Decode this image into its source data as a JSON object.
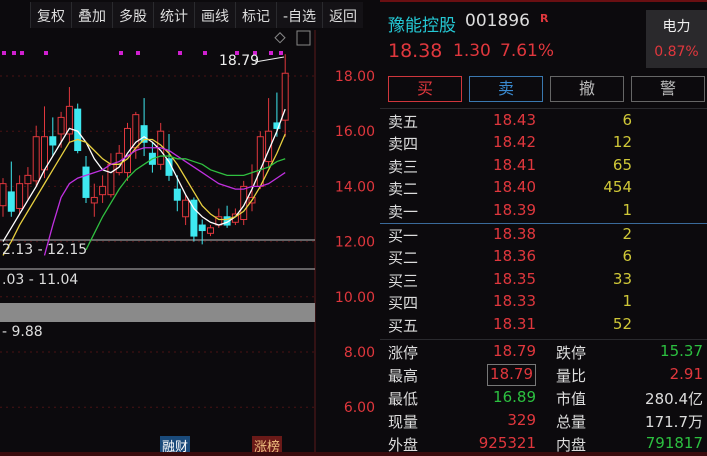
{
  "toolbar": [
    "复权",
    "叠加",
    "多股",
    "统计",
    "画线",
    "标记",
    "-自选",
    "返回"
  ],
  "chart": {
    "high_label": "18.79",
    "price_axis": [
      "18.00",
      "16.00",
      "14.00",
      "12.00",
      "10.00",
      "8.00",
      "6.00"
    ],
    "ranges": [
      "2.13 - 12.15",
      ".03 - 11.04",
      "- 9.88"
    ],
    "tags": [
      "融财",
      "涨榜"
    ]
  },
  "chart_data": {
    "type": "candlestick",
    "ylim": [
      5.2,
      19.6
    ],
    "candles": [
      [
        13.3,
        14.1,
        14.3,
        12.9
      ],
      [
        13.8,
        13.1,
        14.9,
        12.9
      ],
      [
        13.2,
        14.1,
        14.4,
        13.0
      ],
      [
        14.1,
        14.4,
        14.7,
        13.5
      ],
      [
        14.2,
        15.8,
        16.2,
        14.0
      ],
      [
        14.6,
        15.8,
        16.9,
        14.3
      ],
      [
        15.8,
        15.5,
        16.5,
        15.1
      ],
      [
        15.9,
        16.5,
        16.7,
        15.4
      ],
      [
        15.9,
        16.9,
        17.6,
        15.6
      ],
      [
        16.8,
        15.3,
        17.0,
        15.2
      ],
      [
        14.7,
        13.6,
        15.1,
        13.4
      ],
      [
        13.4,
        13.6,
        14.1,
        12.9
      ],
      [
        13.7,
        14.0,
        14.4,
        13.4
      ],
      [
        13.7,
        14.8,
        15.2,
        13.6
      ],
      [
        14.5,
        15.2,
        15.5,
        14.4
      ],
      [
        14.5,
        16.1,
        16.3,
        14.2
      ],
      [
        15.4,
        16.6,
        16.7,
        15.0
      ],
      [
        16.2,
        15.6,
        17.2,
        15.1
      ],
      [
        15.2,
        14.8,
        15.6,
        14.5
      ],
      [
        14.8,
        16.0,
        16.3,
        14.6
      ],
      [
        15.0,
        14.4,
        15.9,
        14.2
      ],
      [
        13.9,
        13.5,
        14.4,
        13.1
      ],
      [
        12.9,
        13.5,
        13.7,
        12.6
      ],
      [
        13.5,
        12.2,
        13.6,
        12.0
      ],
      [
        12.6,
        12.4,
        12.8,
        11.9
      ],
      [
        12.3,
        12.5,
        12.6,
        12.2
      ],
      [
        12.6,
        12.9,
        13.2,
        12.5
      ],
      [
        12.9,
        12.6,
        13.3,
        12.5
      ],
      [
        12.7,
        13.0,
        13.2,
        12.6
      ],
      [
        12.8,
        14.0,
        14.2,
        12.6
      ],
      [
        13.4,
        13.6,
        14.8,
        13.1
      ],
      [
        14.0,
        15.8,
        16.0,
        13.9
      ],
      [
        14.9,
        16.0,
        17.2,
        14.7
      ],
      [
        16.3,
        16.1,
        17.4,
        15.8
      ],
      [
        16.4,
        18.1,
        18.79,
        15.8
      ]
    ],
    "ma": [
      {
        "name": "MA5",
        "color": "#ffffff",
        "values": [
          12.0,
          12.5,
          13.0,
          13.5,
          14.0,
          14.6,
          15.1,
          15.6,
          16.1,
          16.0,
          15.6,
          15.0,
          14.6,
          14.5,
          14.7,
          15.2,
          15.6,
          15.8,
          15.6,
          15.3,
          14.9,
          14.3,
          13.7,
          13.2,
          12.9,
          12.7,
          12.6,
          12.7,
          12.9,
          13.3,
          13.9,
          14.6,
          15.3,
          16.0,
          16.8
        ]
      },
      {
        "name": "MA10",
        "color": "#e8d040",
        "values": [
          11.5,
          12.0,
          12.6,
          13.1,
          13.6,
          14.1,
          14.6,
          15.1,
          15.6,
          15.7,
          15.6,
          15.3,
          15.0,
          14.8,
          14.8,
          15.0,
          15.4,
          15.7,
          15.7,
          15.5,
          15.2,
          14.8,
          14.3,
          13.8,
          13.3,
          13.0,
          12.8,
          12.8,
          12.9,
          13.1,
          13.5,
          14.0,
          14.6,
          15.2,
          15.9
        ]
      },
      {
        "name": "MA20",
        "color": "#c030e0",
        "values": [
          null,
          null,
          null,
          null,
          null,
          11.5,
          12.6,
          13.6,
          14.1,
          14.3,
          14.4,
          14.5,
          14.6,
          14.8,
          14.9,
          15.1,
          15.3,
          15.4,
          15.4,
          15.4,
          15.3,
          15.1,
          14.9,
          14.7,
          14.5,
          14.3,
          14.1,
          14.0,
          13.9,
          13.9,
          14.0,
          14.0,
          14.1,
          14.3,
          14.5
        ]
      },
      {
        "name": "MA60",
        "color": "#30c040",
        "values": [
          null,
          null,
          null,
          null,
          null,
          null,
          null,
          null,
          null,
          null,
          11.7,
          12.3,
          12.9,
          13.4,
          13.9,
          14.3,
          14.6,
          14.8,
          15.0,
          15.1,
          15.1,
          15.0,
          15.0,
          14.9,
          14.8,
          14.6,
          14.5,
          14.4,
          14.4,
          14.4,
          14.5,
          14.6,
          14.7,
          14.9,
          15.0
        ]
      }
    ]
  },
  "stock": {
    "name": "豫能控股",
    "code": "001896",
    "mark": "R",
    "price": "18.38",
    "change": "1.30",
    "pct": "7.61%",
    "sector": "电力",
    "sector_pct": "0.87%"
  },
  "buttons": [
    "买",
    "卖",
    "撤",
    "警"
  ],
  "asks": [
    {
      "label": "卖五",
      "price": "18.43",
      "vol": "6"
    },
    {
      "label": "卖四",
      "price": "18.42",
      "vol": "12"
    },
    {
      "label": "卖三",
      "price": "18.41",
      "vol": "65"
    },
    {
      "label": "卖二",
      "price": "18.40",
      "vol": "454"
    },
    {
      "label": "卖一",
      "price": "18.39",
      "vol": "1"
    }
  ],
  "bids": [
    {
      "label": "买一",
      "price": "18.38",
      "vol": "2"
    },
    {
      "label": "买二",
      "price": "18.36",
      "vol": "6"
    },
    {
      "label": "买三",
      "price": "18.35",
      "vol": "33"
    },
    {
      "label": "买四",
      "price": "18.33",
      "vol": "1"
    },
    {
      "label": "买五",
      "price": "18.31",
      "vol": "52"
    }
  ],
  "stats": [
    {
      "l1": "涨停",
      "v1": "18.79",
      "c1": "#e0373d",
      "l2": "跌停",
      "v2": "15.37",
      "c2": "#2cc040"
    },
    {
      "l1": "最高",
      "v1": "18.79",
      "c1": "#e0373d",
      "l2": "量比",
      "v2": "2.91",
      "c2": "#e0373d"
    },
    {
      "l1": "最低",
      "v1": "16.89",
      "c1": "#2cc040",
      "l2": "市值",
      "v2": "280.4亿",
      "c2": "#dddddd"
    },
    {
      "l1": "现量",
      "v1": "329",
      "c1": "#e0373d",
      "l2": "总量",
      "v2": "171.7万",
      "c2": "#dddddd"
    },
    {
      "l1": "外盘",
      "v1": "925321",
      "c1": "#e0373d",
      "l2": "内盘",
      "v2": "791817",
      "c2": "#2cc040"
    }
  ]
}
